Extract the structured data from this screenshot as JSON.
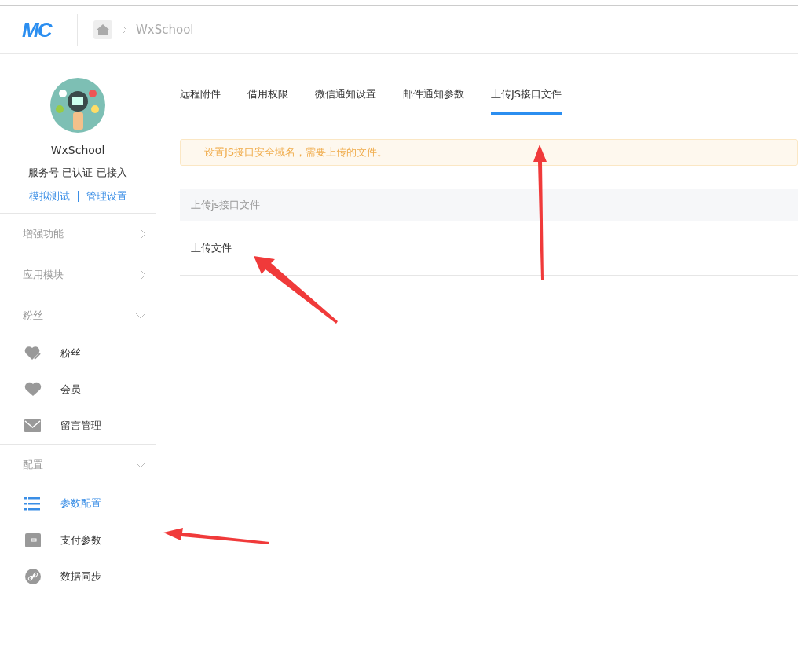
{
  "header": {
    "logo": "MC",
    "breadcrumb": "WxSchool"
  },
  "account": {
    "name": "WxSchool",
    "status": "服务号 已认证 已接入",
    "links": [
      "模拟测试",
      "管理设置"
    ]
  },
  "menu": [
    {
      "label": "增强功能",
      "expanded": false
    },
    {
      "label": "应用模块",
      "expanded": false
    },
    {
      "label": "粉丝",
      "expanded": true,
      "items": [
        {
          "label": "粉丝",
          "selected": false
        },
        {
          "label": "会员",
          "selected": false
        },
        {
          "label": "留言管理",
          "selected": false
        }
      ]
    },
    {
      "label": "配置",
      "expanded": true,
      "items": [
        {
          "label": "参数配置",
          "selected": true
        },
        {
          "label": "支付参数",
          "selected": false
        },
        {
          "label": "数据同步",
          "selected": false
        }
      ]
    }
  ],
  "tabs": [
    {
      "label": "远程附件",
      "selected": false
    },
    {
      "label": "借用权限",
      "selected": false
    },
    {
      "label": "微信通知设置",
      "selected": false
    },
    {
      "label": "邮件通知参数",
      "selected": false
    },
    {
      "label": "上传JS接口文件",
      "selected": true
    }
  ],
  "notice": "设置JS接口安全域名，需要上传的文件。",
  "panel": {
    "heading": "上传js接口文件",
    "rows": [
      "上传文件"
    ]
  }
}
